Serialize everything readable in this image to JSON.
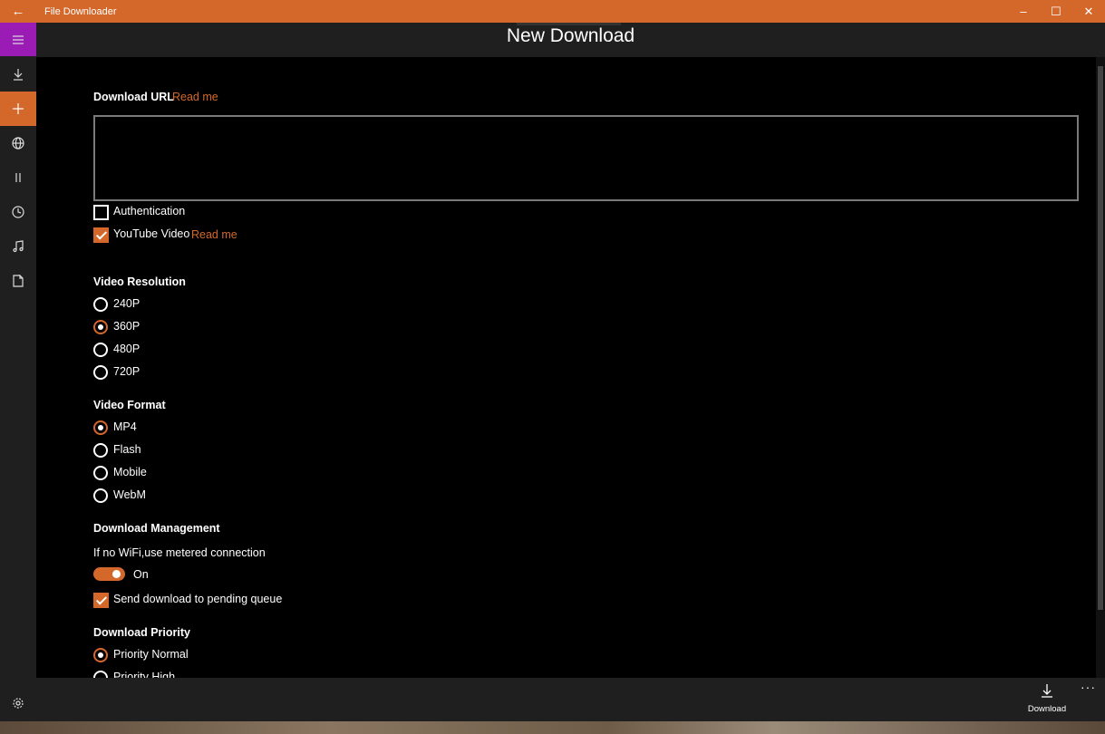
{
  "window": {
    "title": "File Downloader",
    "back_icon": "back-arrow-icon",
    "accent": "#d4682b"
  },
  "header": {
    "title": "New Download"
  },
  "sidebar": {
    "items": [
      {
        "icon": "hamburger-menu-icon",
        "active_color": "#9b1cb5"
      },
      {
        "icon": "download-icon"
      },
      {
        "icon": "plus-icon",
        "selected": true
      },
      {
        "icon": "globe-icon"
      },
      {
        "icon": "pause-icon"
      },
      {
        "icon": "clock-icon"
      },
      {
        "icon": "music-icon"
      },
      {
        "icon": "document-icon"
      },
      {
        "icon": "gear-icon"
      }
    ]
  },
  "form": {
    "url_label": "Download URL",
    "url_readme": "Read me",
    "url_value": "",
    "authentication_label": "Authentication",
    "authentication_checked": false,
    "youtube_label": "YouTube Video",
    "youtube_checked": true,
    "youtube_readme": "Read me",
    "resolution_title": "Video Resolution",
    "resolutions": [
      "240P",
      "360P",
      "480P",
      "720P"
    ],
    "resolution_selected": "360P",
    "format_title": "Video Format",
    "formats": [
      "MP4",
      "Flash",
      "Mobile",
      "WebM"
    ],
    "format_selected": "MP4",
    "management_title": "Download Management",
    "metered_label": "If no WiFi,use metered connection",
    "metered_toggle_state": "On",
    "pending_label": "Send download to pending queue",
    "pending_checked": true,
    "priority_title": "Download Priority",
    "priorities": [
      "Priority Normal",
      "Priority High"
    ],
    "priority_selected": "Priority Normal"
  },
  "bottombar": {
    "download_label": "Download",
    "more_label": "···"
  }
}
